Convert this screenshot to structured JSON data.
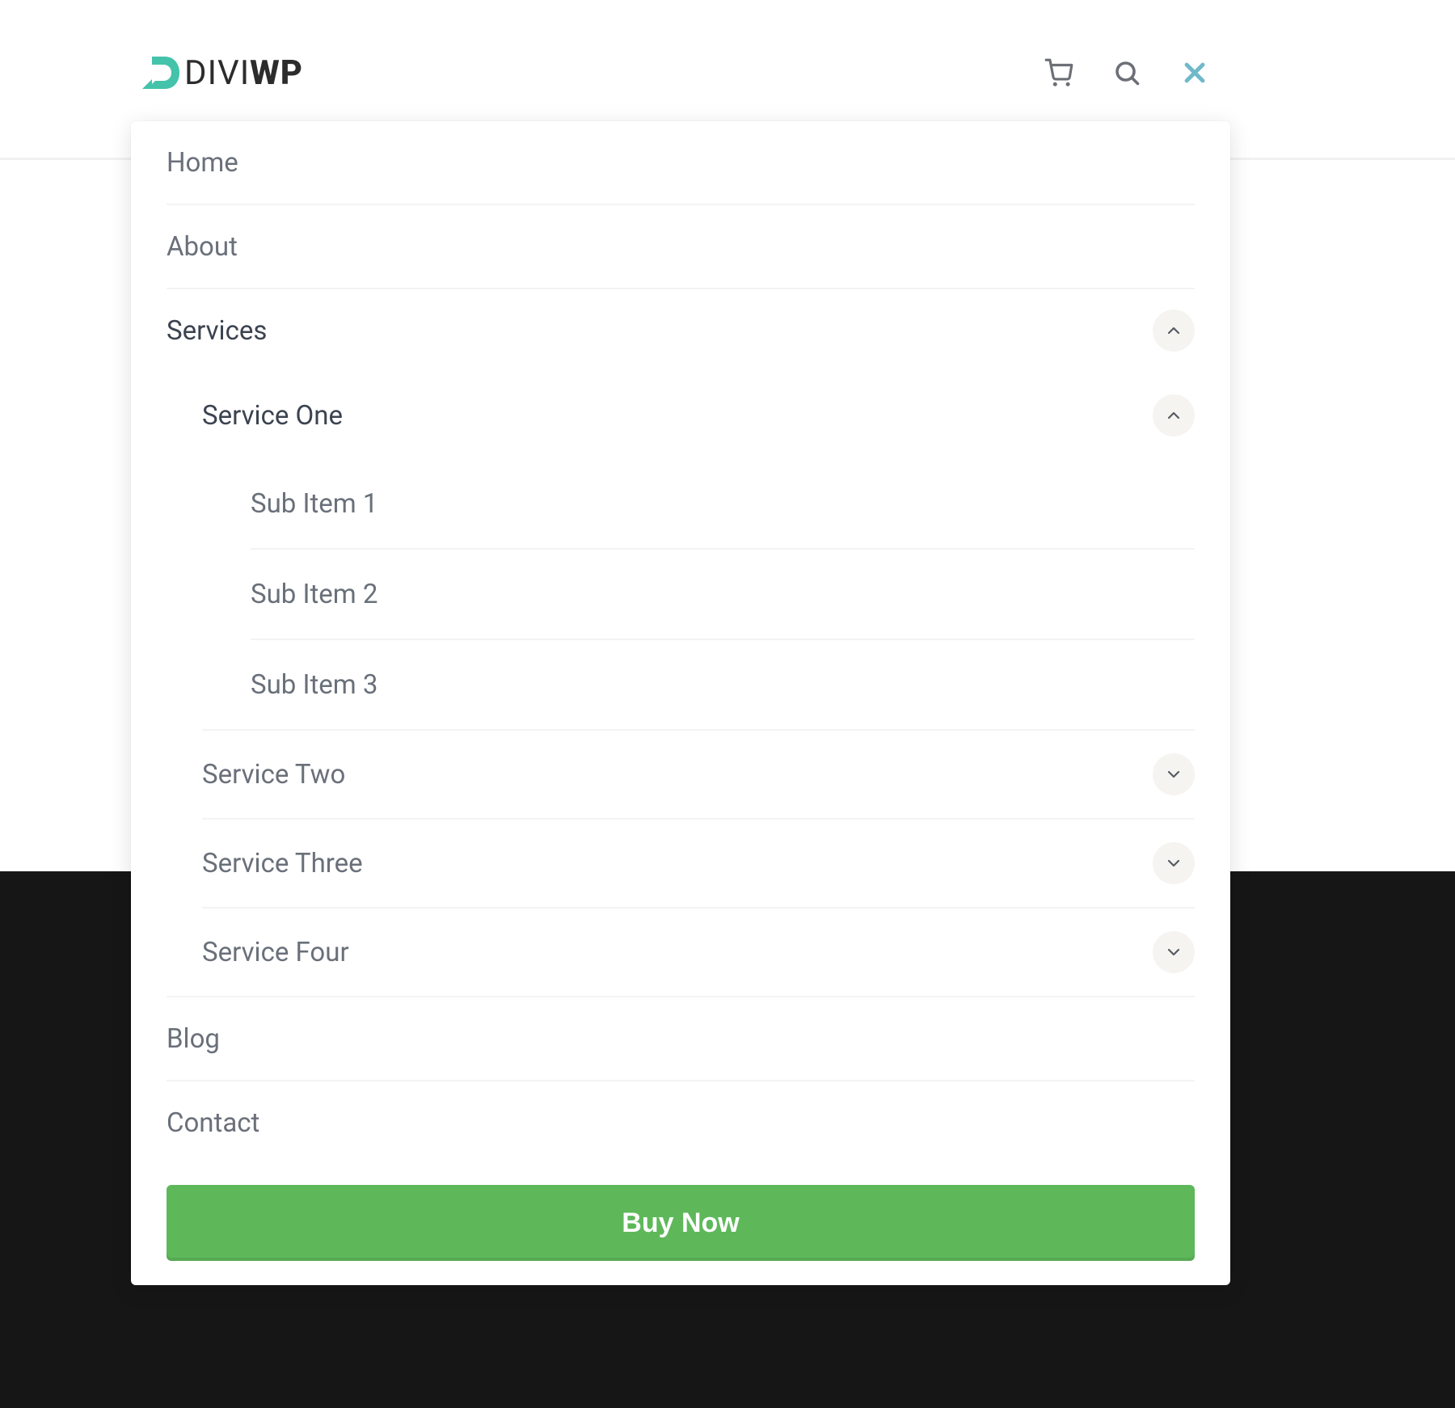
{
  "brand": {
    "part1": "DIVI",
    "part2": "WP"
  },
  "icons": {
    "cart": "cart-icon",
    "search": "search-icon",
    "close": "close-icon"
  },
  "menu": {
    "home": {
      "label": "Home"
    },
    "about": {
      "label": "About"
    },
    "services": {
      "label": "Services",
      "expanded": true,
      "children": {
        "one": {
          "label": "Service One",
          "expanded": true,
          "children": {
            "s1": {
              "label": "Sub Item 1"
            },
            "s2": {
              "label": "Sub Item 2"
            },
            "s3": {
              "label": "Sub Item 3"
            }
          }
        },
        "two": {
          "label": "Service Two",
          "expanded": false
        },
        "three": {
          "label": "Service Three",
          "expanded": false
        },
        "four": {
          "label": "Service Four",
          "expanded": false
        }
      }
    },
    "blog": {
      "label": "Blog"
    },
    "contact": {
      "label": "Contact"
    },
    "cta": {
      "label": "Buy Now"
    }
  },
  "colors": {
    "accent_teal": "#44c3aa",
    "accent_blue": "#6fb9c9",
    "cta_green": "#5eb85a",
    "text_muted": "#6a707a",
    "text_active": "#3b4350",
    "chip_bg": "#f6f4f1"
  }
}
